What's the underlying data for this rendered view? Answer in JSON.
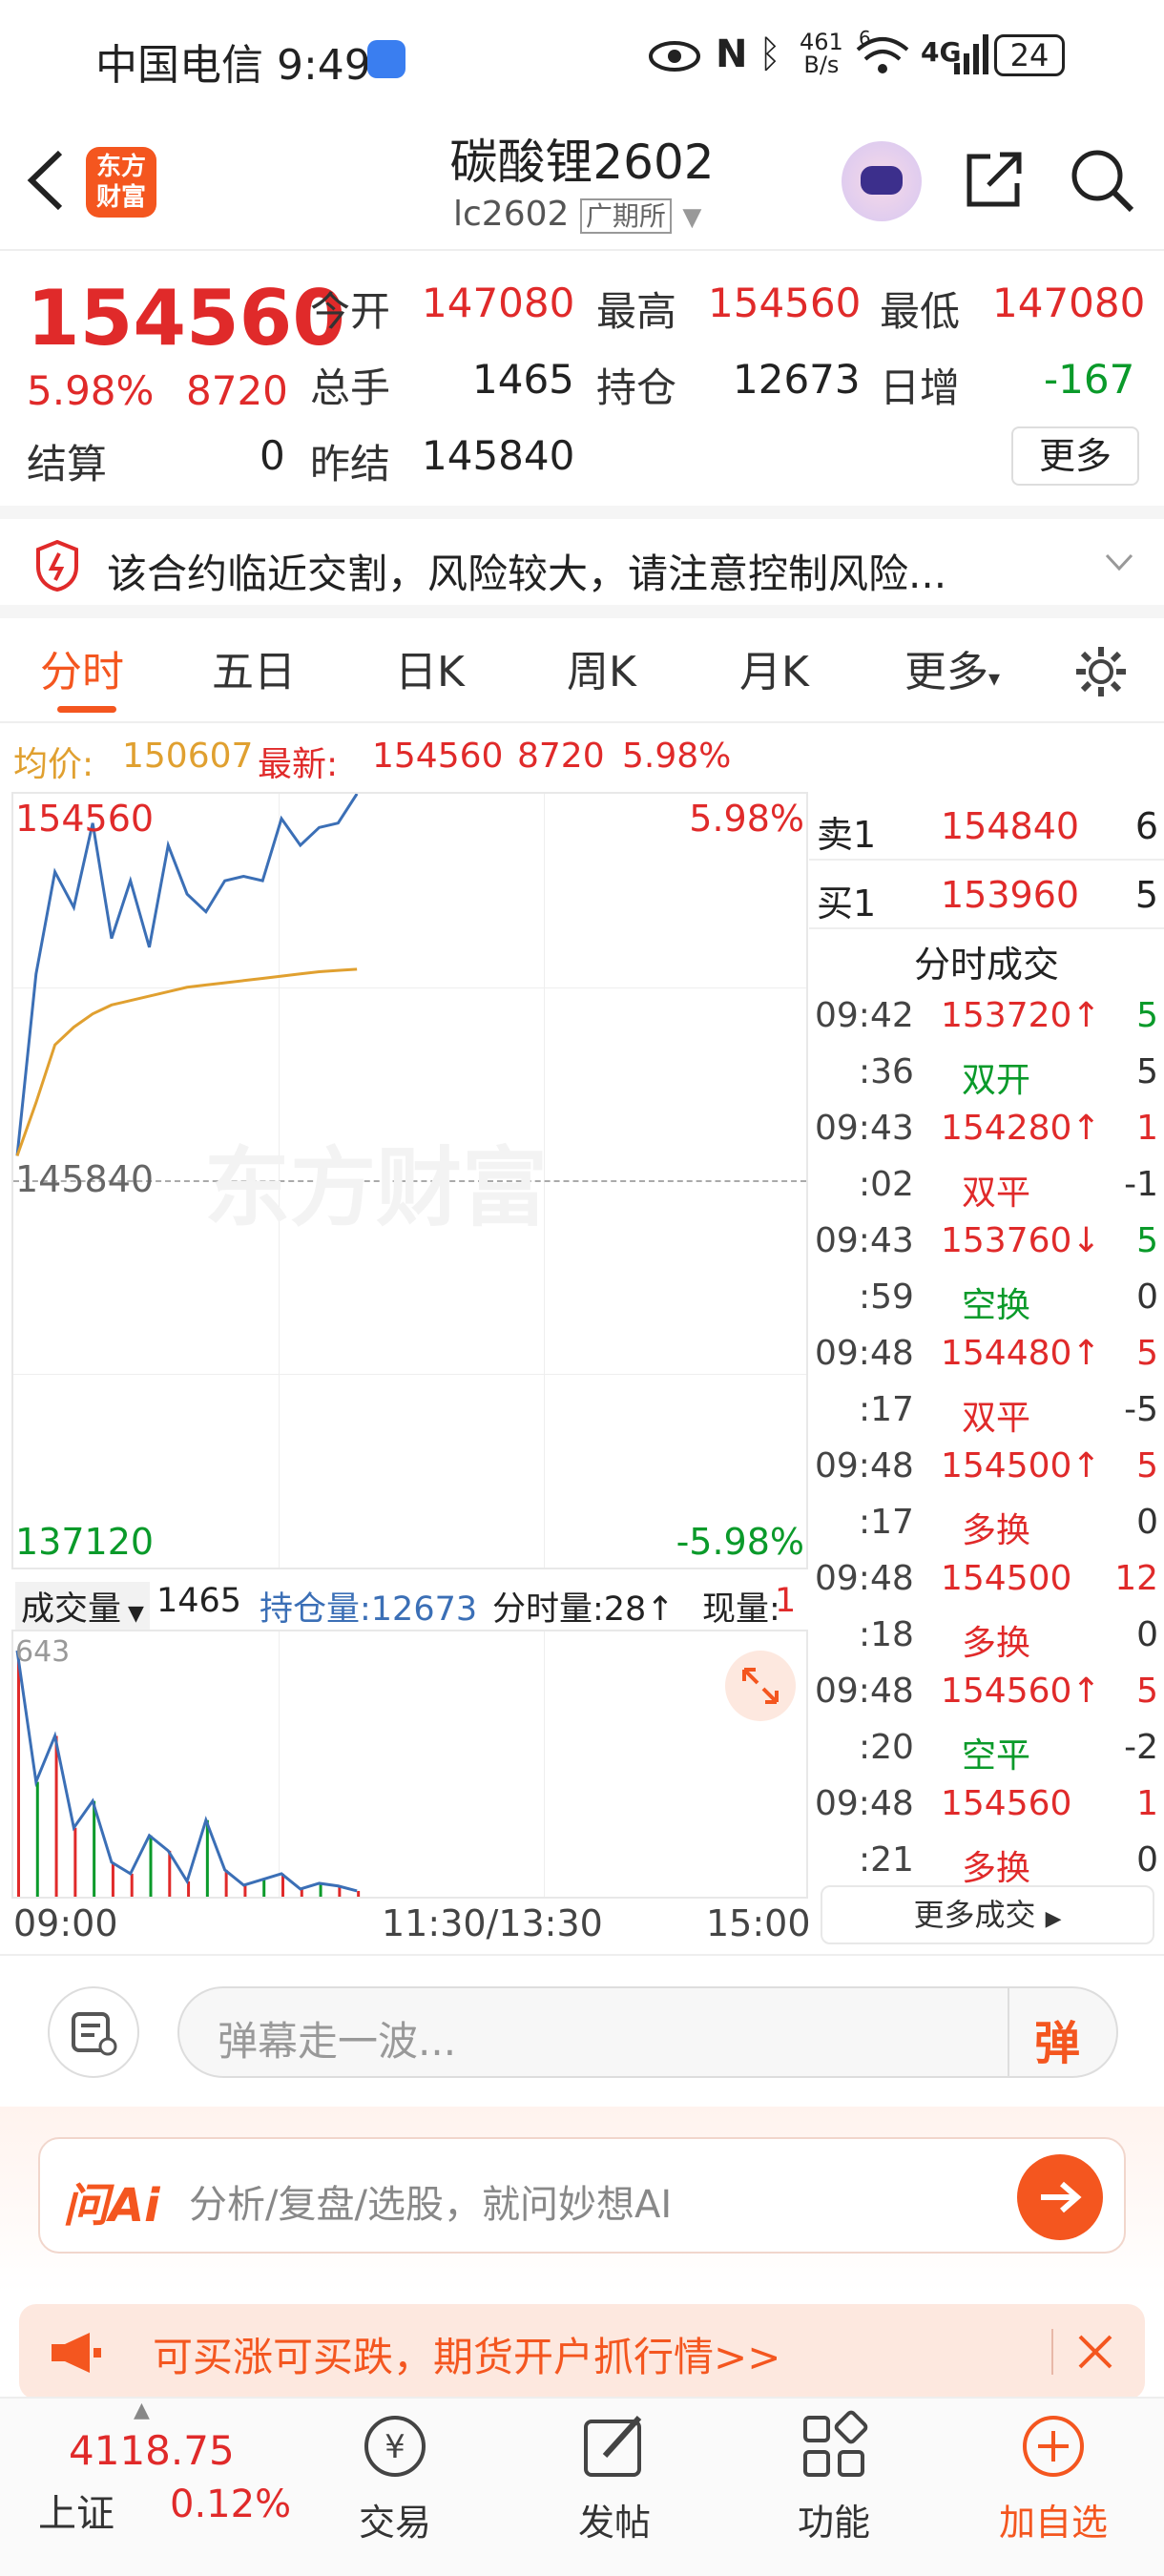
{
  "status_bar": {
    "carrier_time": "中国电信 9:49",
    "net_speed_top": "461",
    "net_speed_bottom": "B/s",
    "wifi_badge": "6",
    "cell_label": "4G",
    "battery": "24"
  },
  "header": {
    "logo_line1": "东方",
    "logo_line2": "财富",
    "title": "碳酸锂2602",
    "code": "lc2602",
    "exchange": "广期所"
  },
  "quote": {
    "price": "154560",
    "change_pct": "5.98%",
    "change_amt": "8720",
    "open_label": "今开",
    "open": "147080",
    "high_label": "最高",
    "high": "154560",
    "low_label": "最低",
    "low": "147080",
    "volume_label": "总手",
    "volume": "1465",
    "oi_label": "持仓",
    "oi": "12673",
    "daily_inc_label": "日增",
    "daily_inc": "-167",
    "settle_label": "结算",
    "settle": "0",
    "prev_settle_label": "昨结",
    "prev_settle": "145840",
    "more_btn": "更多"
  },
  "notice": {
    "text": "该合约临近交割，风险较大，请注意控制风险..."
  },
  "tabs": [
    "分时",
    "五日",
    "日K",
    "周K",
    "月K",
    "更多"
  ],
  "info_line": {
    "avg_label": "均价:",
    "avg": "150607",
    "latest_label": "最新:",
    "latest": "154560",
    "chg": "8720",
    "pct": "5.98%"
  },
  "chart": {
    "top_price": "154560",
    "top_pct": "5.98%",
    "mid_price": "145840",
    "bottom_price": "137120",
    "bottom_pct": "-5.98%",
    "watermark": "东方财富",
    "vol_label": "成交量",
    "vol_value": "1465",
    "oi_label": "持仓量:12673",
    "tick_vol": "分时量:28↑",
    "now_vol_label": "现量:",
    "now_vol": "1",
    "vol_max": "643",
    "x_start": "09:00",
    "x_mid": "11:30/13:30",
    "x_end": "15:00"
  },
  "chart_data": {
    "type": "line",
    "ylim": [
      137120,
      154560
    ],
    "series": [
      {
        "name": "最新",
        "color": "#3b6fb6",
        "values": [
          146400,
          150500,
          152800,
          152000,
          153900,
          151300,
          152600,
          151100,
          153400,
          152300,
          151900,
          152600,
          152700,
          152600,
          154000,
          153400,
          153800,
          153900,
          154560
        ]
      },
      {
        "name": "均价",
        "color": "#e0a030",
        "values": [
          146400,
          147600,
          148900,
          149300,
          149600,
          149800,
          149900,
          150000,
          150100,
          150200,
          150250,
          150300,
          150350,
          150400,
          150450,
          150500,
          150550,
          150580,
          150607
        ]
      }
    ],
    "volume": [
      643,
      300,
      420,
      180,
      250,
      90,
      60,
      160,
      120,
      40,
      200,
      70,
      30,
      45,
      60,
      20,
      35,
      28,
      15
    ]
  },
  "orderbook": {
    "sell_label": "卖1",
    "sell_price": "154840",
    "sell_qty": "6",
    "buy_label": "买1",
    "buy_price": "153960",
    "buy_qty": "5",
    "ticks_title": "分时成交",
    "more_ticks": "更多成交",
    "ticks": [
      {
        "t": "09:42",
        "v": "153720↑",
        "q": "5",
        "c": "red",
        "qc": "green"
      },
      {
        "t": ":36",
        "v": "双开",
        "q": "5",
        "c": "green",
        "qc": "gray"
      },
      {
        "t": "09:43",
        "v": "154280↑",
        "q": "1",
        "c": "red",
        "qc": "red"
      },
      {
        "t": ":02",
        "v": "双平",
        "q": "-1",
        "c": "red",
        "qc": "gray"
      },
      {
        "t": "09:43",
        "v": "153760↓",
        "q": "5",
        "c": "red",
        "qc": "green"
      },
      {
        "t": ":59",
        "v": "空换",
        "q": "0",
        "c": "green",
        "qc": "gray"
      },
      {
        "t": "09:48",
        "v": "154480↑",
        "q": "5",
        "c": "red",
        "qc": "red"
      },
      {
        "t": ":17",
        "v": "双平",
        "q": "-5",
        "c": "red",
        "qc": "gray"
      },
      {
        "t": "09:48",
        "v": "154500↑",
        "q": "5",
        "c": "red",
        "qc": "red"
      },
      {
        "t": ":17",
        "v": "多换",
        "q": "0",
        "c": "red",
        "qc": "gray"
      },
      {
        "t": "09:48",
        "v": "154500",
        "q": "12",
        "c": "red",
        "qc": "red"
      },
      {
        "t": ":18",
        "v": "多换",
        "q": "0",
        "c": "red",
        "qc": "gray"
      },
      {
        "t": "09:48",
        "v": "154560↑",
        "q": "5",
        "c": "red",
        "qc": "red"
      },
      {
        "t": ":20",
        "v": "空平",
        "q": "-2",
        "c": "green",
        "qc": "gray"
      },
      {
        "t": "09:48",
        "v": "154560",
        "q": "1",
        "c": "red",
        "qc": "red"
      },
      {
        "t": ":21",
        "v": "多换",
        "q": "0",
        "c": "red",
        "qc": "gray"
      }
    ]
  },
  "danmu": {
    "placeholder": "弹幕走一波...",
    "btn": "弹"
  },
  "ai": {
    "logo": "问Ai",
    "placeholder": "分析/复盘/选股，就问妙想AI"
  },
  "promo": {
    "text": "可买涨可买跌，期货开户抓行情>>"
  },
  "nav": {
    "index_value": "4118.75",
    "index_name": "上证",
    "index_pct": "0.12%",
    "trade": "交易",
    "post": "发帖",
    "func": "功能",
    "add": "加自选"
  },
  "colors": {
    "red": "#e02a2a",
    "green": "#0a9a2a",
    "accent": "#f4561f",
    "price_line": "#3b6fb6",
    "avg_line": "#e0a030"
  }
}
